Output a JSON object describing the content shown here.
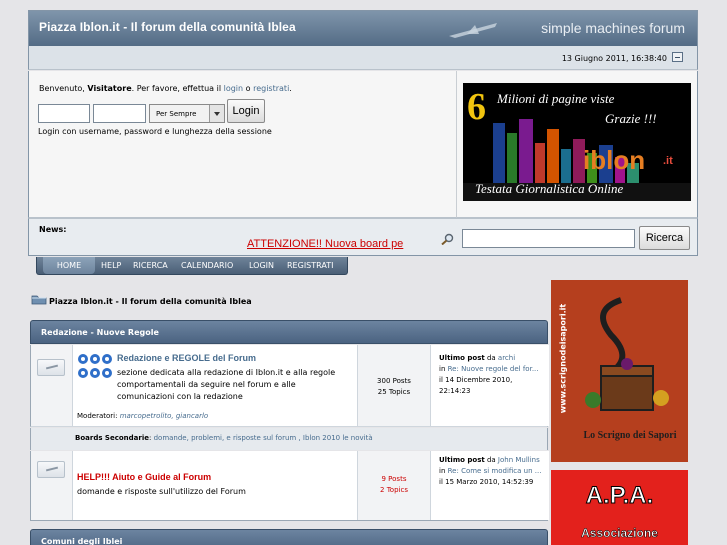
{
  "header": {
    "title": "Piazza Iblon.it - Il forum della comunità Iblea",
    "logo_text": "simple machines forum"
  },
  "datebar": {
    "date": "13 Giugno 2011, 16:38:40"
  },
  "userbox": {
    "welcome_prefix": "Benvenuto, ",
    "visitor": "Visitatore",
    "welcome_mid": ". Per favore, effettua il ",
    "login_link": "login",
    "or": " o ",
    "register_link": "registrati",
    "end": ".",
    "duration": "Per Sempre",
    "login_button": "Login",
    "hint": "Login con username, password e lunghezza della sessione"
  },
  "banner": {
    "big_number": "6",
    "line1": "Milioni di pagine viste",
    "line2": "Grazie !!!",
    "brand": "iblon",
    "brand_suffix": ".it",
    "tagline": "Testata Giornalistica Online"
  },
  "news": {
    "label": "News:",
    "ticker": "ATTENZIONE!! Nuova board pe",
    "search_button": "Ricerca"
  },
  "menu": {
    "items": [
      "HOME",
      "HELP",
      "RICERCA",
      "CALENDARIO",
      "LOGIN",
      "REGISTRATI"
    ]
  },
  "breadcrumb": "Piazza Iblon.it - Il forum della comunità Iblea",
  "categories": [
    {
      "title": "Redazione - Nuove Regole",
      "boards": [
        {
          "title": "Redazione e REGOLE del Forum",
          "desc": "sezione dedicata alla redazione di Iblon.it e alla regole comportamentali da seguire nel forum e alle comunicazioni con la redazione",
          "moderators_label": "Moderatori:",
          "moderators": "marcopetrolito, giancarlo",
          "posts": "300 Posts",
          "topics": "25 Topics",
          "last_prefix": "Ultimo post",
          "last_by": "da",
          "last_user": "archi",
          "last_in": "in",
          "last_topic": "Re: Nuove regole del for...",
          "last_date": "il 14 Dicembre 2010, 22:14:23"
        }
      ],
      "sub_label": "Boards Secondarie",
      "sub_links": "domande, problemi, e risposte sul forum , Iblon 2010 le novità"
    },
    {
      "boards": [
        {
          "title": "HELP!!! Aiuto e Guide al Forum",
          "desc": "domande e risposte sull'utilizzo del Forum",
          "posts": "9 Posts",
          "topics": "2 Topics",
          "last_prefix": "Ultimo post",
          "last_by": "da",
          "last_user": "John Mullins",
          "last_in": "in",
          "last_topic": "Re: Come si modifica un ...",
          "last_date": "il 15 Marzo 2010, 14:52:39"
        }
      ]
    },
    {
      "title": "Comuni degli Iblei"
    }
  ],
  "side_ads": {
    "scrigno_url_text": "www.scrignodeisapori.it",
    "scrigno_caption": "Lo Scrigno dei Sapori",
    "apa_title": "A.P.A.",
    "apa_sub": "Associazione"
  },
  "colors": {
    "header_top": "#7f95ab",
    "header_bottom": "#536b85",
    "link": "#476c8e",
    "news_red": "#cc0000",
    "help_red": "#cc0000"
  }
}
